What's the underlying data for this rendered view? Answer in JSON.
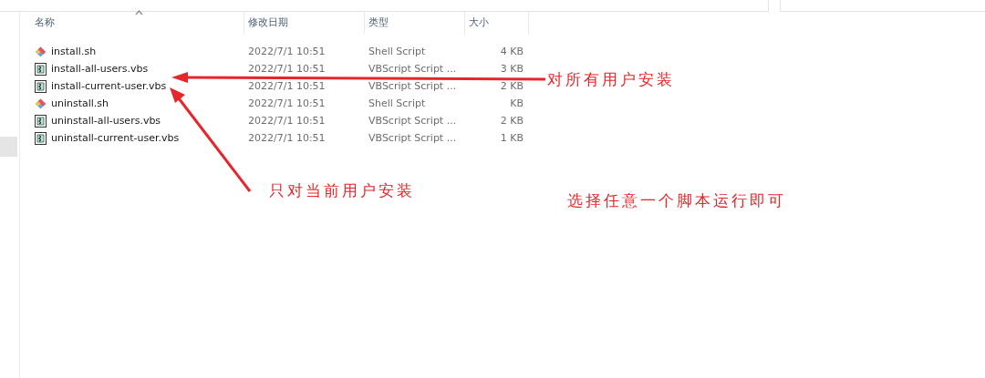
{
  "table": {
    "columns": [
      {
        "label": "名称",
        "sorted": true
      },
      {
        "label": "修改日期",
        "sorted": false
      },
      {
        "label": "类型",
        "sorted": false
      },
      {
        "label": "大小",
        "sorted": false
      }
    ],
    "rows": [
      {
        "name": "install.sh",
        "kind": "shell",
        "date": "2022/7/1 10:51",
        "type": "Shell Script",
        "size": "4 KB"
      },
      {
        "name": "install-all-users.vbs",
        "kind": "vbs",
        "date": "2022/7/1 10:51",
        "type": "VBScript Script ...",
        "size": "3 KB"
      },
      {
        "name": "install-current-user.vbs",
        "kind": "vbs",
        "date": "2022/7/1 10:51",
        "type": "VBScript Script ...",
        "size": "2 KB"
      },
      {
        "name": "uninstall.sh",
        "kind": "shell",
        "date": "2022/7/1 10:51",
        "type": "Shell Script",
        "size": "KB"
      },
      {
        "name": "uninstall-all-users.vbs",
        "kind": "vbs",
        "date": "2022/7/1 10:51",
        "type": "VBScript Script ...",
        "size": "2 KB"
      },
      {
        "name": "uninstall-current-user.vbs",
        "kind": "vbs",
        "date": "2022/7/1 10:51",
        "type": "VBScript Script ...",
        "size": "1 KB"
      }
    ]
  },
  "annotations": [
    {
      "text": "对所有用户安装"
    },
    {
      "text": "只对当前用户安装"
    },
    {
      "text": "选择任意一个脚本运行即可"
    }
  ]
}
